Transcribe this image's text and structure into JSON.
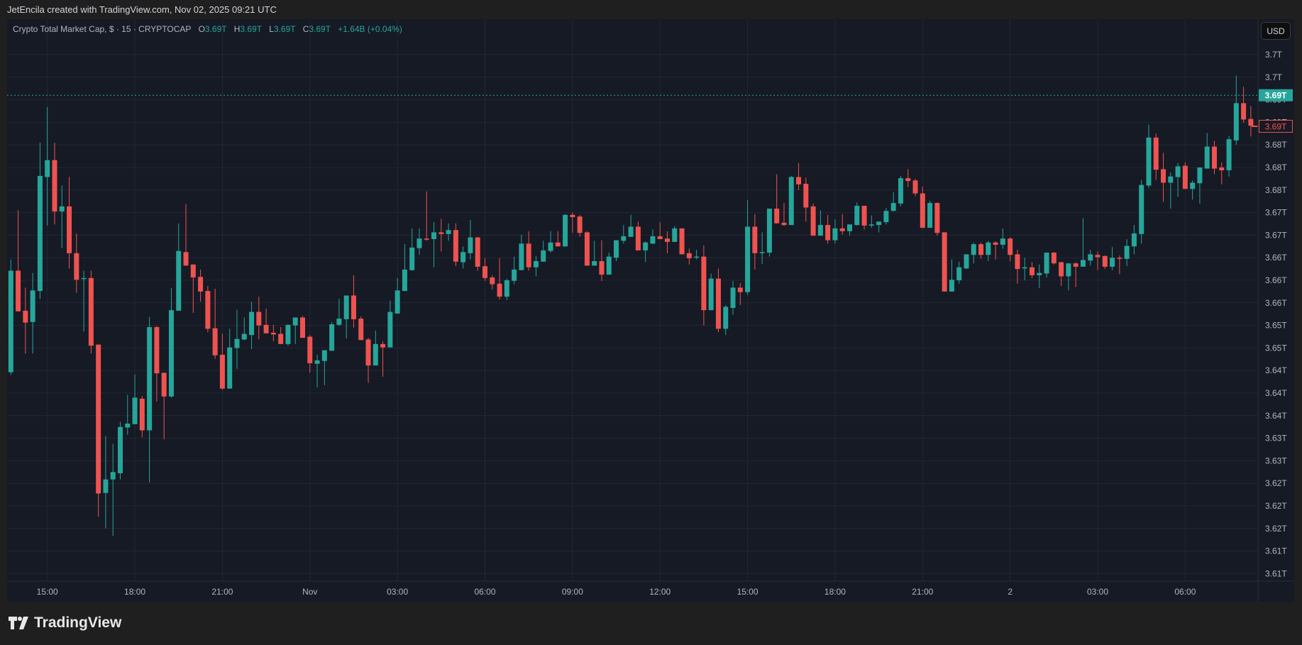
{
  "attribution": "JetEncila created with TradingView.com, Nov 02, 2025 09:21 UTC",
  "legend": {
    "symbol": "Crypto Total Market Cap, $ · 15 · CRYPTOCAP",
    "o_label": "O",
    "o": "3.69T",
    "h_label": "H",
    "h": "3.69T",
    "l_label": "L",
    "l": "3.69T",
    "c_label": "C",
    "c": "3.69T",
    "change": "+1.64B (+0.04%)"
  },
  "currency_button": "USD",
  "logo_text": "TradingView",
  "colors": {
    "up": "#26a69a",
    "down": "#ef5350",
    "grid": "#232734",
    "background": "#161a25",
    "axis_text": "#b2b5be"
  },
  "price_marker": {
    "value": 3.6928,
    "label": "3.69T"
  },
  "last_price": {
    "value": 3.6873,
    "label": "3.69T"
  },
  "price_ticks": [
    {
      "value": 3.7,
      "label": "3.7T"
    },
    {
      "value": 3.696,
      "label": "3.7T"
    },
    {
      "value": 3.692,
      "label": "3.69T"
    },
    {
      "value": 3.688,
      "label": "3.69T"
    },
    {
      "value": 3.684,
      "label": "3.68T"
    },
    {
      "value": 3.68,
      "label": "3.68T"
    },
    {
      "value": 3.676,
      "label": "3.68T"
    },
    {
      "value": 3.672,
      "label": "3.67T"
    },
    {
      "value": 3.668,
      "label": "3.67T"
    },
    {
      "value": 3.664,
      "label": "3.66T"
    },
    {
      "value": 3.66,
      "label": "3.66T"
    },
    {
      "value": 3.656,
      "label": "3.66T"
    },
    {
      "value": 3.652,
      "label": "3.65T"
    },
    {
      "value": 3.648,
      "label": "3.65T"
    },
    {
      "value": 3.644,
      "label": "3.64T"
    },
    {
      "value": 3.64,
      "label": "3.64T"
    },
    {
      "value": 3.636,
      "label": "3.64T"
    },
    {
      "value": 3.632,
      "label": "3.63T"
    },
    {
      "value": 3.628,
      "label": "3.63T"
    },
    {
      "value": 3.624,
      "label": "3.62T"
    },
    {
      "value": 3.62,
      "label": "3.62T"
    },
    {
      "value": 3.616,
      "label": "3.62T"
    },
    {
      "value": 3.612,
      "label": "3.61T"
    },
    {
      "value": 3.608,
      "label": "3.61T"
    }
  ],
  "time_ticks": [
    {
      "bar": 5,
      "label": "15:00"
    },
    {
      "bar": 17,
      "label": "18:00"
    },
    {
      "bar": 29,
      "label": "21:00"
    },
    {
      "bar": 41,
      "label": "Nov"
    },
    {
      "bar": 53,
      "label": "03:00"
    },
    {
      "bar": 65,
      "label": "06:00"
    },
    {
      "bar": 77,
      "label": "09:00"
    },
    {
      "bar": 89,
      "label": "12:00"
    },
    {
      "bar": 101,
      "label": "15:00"
    },
    {
      "bar": 113,
      "label": "18:00"
    },
    {
      "bar": 125,
      "label": "21:00"
    },
    {
      "bar": 137,
      "label": "2"
    },
    {
      "bar": 149,
      "label": "03:00"
    },
    {
      "bar": 161,
      "label": "06:00"
    }
  ],
  "chart_data": {
    "type": "candlestick",
    "title": "Crypto Total Market Cap, $ · 15 · CRYPTOCAP",
    "interval_minutes": 15,
    "unit": "T USD",
    "ylim": [
      3.606,
      3.704
    ],
    "ohlc_order": [
      "open",
      "high",
      "low",
      "close"
    ],
    "ohlc": [
      [
        3.6437,
        3.6637,
        3.6432,
        3.6617
      ],
      [
        3.6617,
        3.6724,
        3.6545,
        3.6545
      ],
      [
        3.6546,
        3.6587,
        3.647,
        3.6525
      ],
      [
        3.6526,
        3.6613,
        3.647,
        3.6582
      ],
      [
        3.6581,
        3.6844,
        3.6567,
        3.6785
      ],
      [
        3.6783,
        3.6907,
        3.6697,
        3.6813
      ],
      [
        3.6813,
        3.6844,
        3.6699,
        3.6722
      ],
      [
        3.6722,
        3.6768,
        3.6657,
        3.6731
      ],
      [
        3.6731,
        3.6783,
        3.6621,
        3.6648
      ],
      [
        3.6648,
        3.6683,
        3.6578,
        3.6601
      ],
      [
        3.6603,
        3.6617,
        3.6509,
        3.6604
      ],
      [
        3.6604,
        3.6617,
        3.647,
        3.6484
      ],
      [
        3.6486,
        3.6486,
        3.6181,
        3.6222
      ],
      [
        3.6223,
        3.6324,
        3.616,
        3.6247
      ],
      [
        3.6247,
        3.631,
        3.6147,
        3.626
      ],
      [
        3.6258,
        3.6349,
        3.6247,
        3.634
      ],
      [
        3.6339,
        3.6397,
        3.6326,
        3.6346
      ],
      [
        3.6345,
        3.6433,
        3.6345,
        3.6392
      ],
      [
        3.639,
        3.6395,
        3.6322,
        3.6334
      ],
      [
        3.6334,
        3.6535,
        3.6242,
        3.6517
      ],
      [
        3.6517,
        3.6519,
        3.6385,
        3.6435
      ],
      [
        3.6436,
        3.6436,
        3.6318,
        3.6394
      ],
      [
        3.6394,
        3.6586,
        3.6392,
        3.6547
      ],
      [
        3.6546,
        3.6701,
        3.6546,
        3.6652
      ],
      [
        3.665,
        3.6735,
        3.6626,
        3.6626
      ],
      [
        3.6628,
        3.6628,
        3.6542,
        3.6605
      ],
      [
        3.6606,
        3.6619,
        3.6562,
        3.658
      ],
      [
        3.6581,
        3.659,
        3.6508,
        3.6514
      ],
      [
        3.6515,
        3.6585,
        3.6461,
        3.6467
      ],
      [
        3.6468,
        3.6505,
        3.6406,
        3.6408
      ],
      [
        3.6408,
        3.6514,
        3.6408,
        3.6481
      ],
      [
        3.648,
        3.6548,
        3.6443,
        3.6496
      ],
      [
        3.6495,
        3.6534,
        3.6494,
        3.6505
      ],
      [
        3.6503,
        3.6562,
        3.6478,
        3.6544
      ],
      [
        3.6544,
        3.6571,
        3.6495,
        3.652
      ],
      [
        3.6521,
        3.655,
        3.6506,
        3.6506
      ],
      [
        3.6507,
        3.6521,
        3.6492,
        3.6504
      ],
      [
        3.6505,
        3.6517,
        3.6487,
        3.6487
      ],
      [
        3.6487,
        3.6522,
        3.6484,
        3.6521
      ],
      [
        3.652,
        3.6534,
        3.6487,
        3.6534
      ],
      [
        3.6534,
        3.6537,
        3.6498,
        3.6498
      ],
      [
        3.65,
        3.6503,
        3.6436,
        3.6453
      ],
      [
        3.6452,
        3.6468,
        3.641,
        3.6458
      ],
      [
        3.6457,
        3.6476,
        3.6414,
        3.6476
      ],
      [
        3.6475,
        3.6526,
        3.6475,
        3.6522
      ],
      [
        3.6521,
        3.6567,
        3.6519,
        3.6532
      ],
      [
        3.6531,
        3.6573,
        3.6497,
        3.6573
      ],
      [
        3.6573,
        3.6609,
        3.6516,
        3.6531
      ],
      [
        3.6532,
        3.6536,
        3.6494,
        3.6494
      ],
      [
        3.6495,
        3.6498,
        3.6418,
        3.6449
      ],
      [
        3.6449,
        3.6511,
        3.6449,
        3.6487
      ],
      [
        3.6487,
        3.6492,
        3.6429,
        3.6481
      ],
      [
        3.6481,
        3.6564,
        3.6481,
        3.6544
      ],
      [
        3.6541,
        3.6604,
        3.6541,
        3.6582
      ],
      [
        3.6581,
        3.6664,
        3.6581,
        3.6619
      ],
      [
        3.6618,
        3.6692,
        3.6617,
        3.6658
      ],
      [
        3.6657,
        3.6692,
        3.6645,
        3.6674
      ],
      [
        3.6674,
        3.6758,
        3.667,
        3.6672
      ],
      [
        3.6673,
        3.6703,
        3.6623,
        3.6685
      ],
      [
        3.6685,
        3.6709,
        3.6651,
        3.6682
      ],
      [
        3.6682,
        3.6701,
        3.667,
        3.6689
      ],
      [
        3.6689,
        3.6701,
        3.6625,
        3.6633
      ],
      [
        3.6632,
        3.666,
        3.6621,
        3.665
      ],
      [
        3.6648,
        3.6707,
        3.6637,
        3.6676
      ],
      [
        3.6676,
        3.6677,
        3.6617,
        3.6624
      ],
      [
        3.6625,
        3.6639,
        3.6599,
        3.6604
      ],
      [
        3.6605,
        3.6609,
        3.6584,
        3.6593
      ],
      [
        3.6594,
        3.6639,
        3.6566,
        3.6571
      ],
      [
        3.6571,
        3.6603,
        3.6565,
        3.66
      ],
      [
        3.6599,
        3.6642,
        3.6593,
        3.6619
      ],
      [
        3.6618,
        3.6681,
        3.6618,
        3.6665
      ],
      [
        3.6665,
        3.6687,
        3.6617,
        3.6623
      ],
      [
        3.6623,
        3.6643,
        3.6607,
        3.6634
      ],
      [
        3.6633,
        3.667,
        3.6633,
        3.6653
      ],
      [
        3.6652,
        3.6687,
        3.6649,
        3.6667
      ],
      [
        3.6667,
        3.6687,
        3.666,
        3.666
      ],
      [
        3.666,
        3.6717,
        3.666,
        3.6716
      ],
      [
        3.6716,
        3.672,
        3.6684,
        3.6712
      ],
      [
        3.6713,
        3.6716,
        3.6677,
        3.6684
      ],
      [
        3.6685,
        3.6687,
        3.6626,
        3.6626
      ],
      [
        3.6626,
        3.667,
        3.6626,
        3.6634
      ],
      [
        3.6634,
        3.6671,
        3.6599,
        3.661
      ],
      [
        3.661,
        3.6649,
        3.661,
        3.6642
      ],
      [
        3.664,
        3.6671,
        3.6634,
        3.6671
      ],
      [
        3.667,
        3.6698,
        3.6665,
        3.6678
      ],
      [
        3.6677,
        3.6716,
        3.6677,
        3.6695
      ],
      [
        3.6695,
        3.6704,
        3.6653,
        3.6653
      ],
      [
        3.6653,
        3.6669,
        3.6632,
        3.6667
      ],
      [
        3.6665,
        3.669,
        3.6664,
        3.6678
      ],
      [
        3.6678,
        3.6703,
        3.6673,
        3.6673
      ],
      [
        3.6674,
        3.6687,
        3.6648,
        3.6668
      ],
      [
        3.6668,
        3.6696,
        3.6668,
        3.6692
      ],
      [
        3.6692,
        3.6692,
        3.6646,
        3.6646
      ],
      [
        3.6648,
        3.6656,
        3.6628,
        3.6639
      ],
      [
        3.6641,
        3.6654,
        3.6637,
        3.6642
      ],
      [
        3.6642,
        3.6662,
        3.652,
        3.6547
      ],
      [
        3.6547,
        3.6612,
        3.6547,
        3.6603
      ],
      [
        3.6603,
        3.6621,
        3.6508,
        3.6514
      ],
      [
        3.6514,
        3.6556,
        3.6503,
        3.6553
      ],
      [
        3.6551,
        3.6599,
        3.6539,
        3.6587
      ],
      [
        3.6587,
        3.6595,
        3.6556,
        3.6579
      ],
      [
        3.6579,
        3.6742,
        3.6574,
        3.6695
      ],
      [
        3.6695,
        3.6717,
        3.6619,
        3.6648
      ],
      [
        3.6648,
        3.6685,
        3.6629,
        3.665
      ],
      [
        3.6649,
        3.6727,
        3.6642,
        3.6727
      ],
      [
        3.6727,
        3.6788,
        3.6701,
        3.6701
      ],
      [
        3.6702,
        3.6737,
        3.6696,
        3.6698
      ],
      [
        3.6698,
        3.6785,
        3.6698,
        3.6783
      ],
      [
        3.6783,
        3.6808,
        3.676,
        3.677
      ],
      [
        3.6771,
        3.6782,
        3.6704,
        3.6729
      ],
      [
        3.6731,
        3.6736,
        3.6679,
        3.6679
      ],
      [
        3.6679,
        3.6724,
        3.6679,
        3.6698
      ],
      [
        3.6698,
        3.6716,
        3.6665,
        3.6671
      ],
      [
        3.6671,
        3.6708,
        3.6665,
        3.6692
      ],
      [
        3.6692,
        3.6717,
        3.6681,
        3.6687
      ],
      [
        3.6687,
        3.6699,
        3.6679,
        3.6699
      ],
      [
        3.6698,
        3.6738,
        3.6697,
        3.6732
      ],
      [
        3.6732,
        3.6732,
        3.669,
        3.6697
      ],
      [
        3.6697,
        3.6715,
        3.6693,
        3.6699
      ],
      [
        3.6698,
        3.6704,
        3.6685,
        3.6704
      ],
      [
        3.6703,
        3.6728,
        3.6699,
        3.6723
      ],
      [
        3.6723,
        3.6756,
        3.6722,
        3.6737
      ],
      [
        3.6736,
        3.6785,
        3.6731,
        3.6781
      ],
      [
        3.6781,
        3.6797,
        3.6765,
        3.6776
      ],
      [
        3.6777,
        3.678,
        3.6749,
        3.6754
      ],
      [
        3.6754,
        3.6766,
        3.6693,
        3.6693
      ],
      [
        3.6693,
        3.6741,
        3.6693,
        3.6737
      ],
      [
        3.6737,
        3.6738,
        3.6679,
        3.6684
      ],
      [
        3.6685,
        3.6685,
        3.658,
        3.658
      ],
      [
        3.658,
        3.6637,
        3.658,
        3.6601
      ],
      [
        3.66,
        3.6633,
        3.6594,
        3.6623
      ],
      [
        3.6621,
        3.6646,
        3.662,
        3.6646
      ],
      [
        3.6645,
        3.6667,
        3.663,
        3.6664
      ],
      [
        3.6664,
        3.6667,
        3.6638,
        3.6645
      ],
      [
        3.6645,
        3.667,
        3.6634,
        3.6667
      ],
      [
        3.6667,
        3.6669,
        3.6637,
        3.6663
      ],
      [
        3.6663,
        3.6692,
        3.6656,
        3.6674
      ],
      [
        3.6674,
        3.6676,
        3.6634,
        3.6645
      ],
      [
        3.6646,
        3.6654,
        3.6594,
        3.662
      ],
      [
        3.6621,
        3.664,
        3.66,
        3.6623
      ],
      [
        3.6623,
        3.6632,
        3.6604,
        3.6609
      ],
      [
        3.6609,
        3.6628,
        3.6586,
        3.6613
      ],
      [
        3.6612,
        3.6649,
        3.6605,
        3.6649
      ],
      [
        3.6649,
        3.665,
        3.6628,
        3.663
      ],
      [
        3.6632,
        3.6633,
        3.659,
        3.6607
      ],
      [
        3.6607,
        3.663,
        3.6582,
        3.663
      ],
      [
        3.663,
        3.6632,
        3.6588,
        3.6624
      ],
      [
        3.6624,
        3.671,
        3.6624,
        3.6636
      ],
      [
        3.6635,
        3.6654,
        3.6626,
        3.6646
      ],
      [
        3.6645,
        3.6651,
        3.6618,
        3.6641
      ],
      [
        3.6643,
        3.6644,
        3.662,
        3.6624
      ],
      [
        3.6624,
        3.6659,
        3.6618,
        3.664
      ],
      [
        3.664,
        3.6644,
        3.6611,
        3.6639
      ],
      [
        3.6638,
        3.6673,
        3.6625,
        3.6661
      ],
      [
        3.666,
        3.6698,
        3.6646,
        3.6683
      ],
      [
        3.6682,
        3.6778,
        3.6665,
        3.6769
      ],
      [
        3.6768,
        3.6876,
        3.6764,
        3.6853
      ],
      [
        3.6853,
        3.686,
        3.6778,
        3.6796
      ],
      [
        3.6797,
        3.6826,
        3.6739,
        3.6773
      ],
      [
        3.6773,
        3.6791,
        3.6727,
        3.6784
      ],
      [
        3.6783,
        3.6808,
        3.6748,
        3.6802
      ],
      [
        3.6803,
        3.6809,
        3.6762,
        3.6762
      ],
      [
        3.6762,
        3.6777,
        3.6743,
        3.6773
      ],
      [
        3.6772,
        3.68,
        3.6736,
        3.68
      ],
      [
        3.6798,
        3.6861,
        3.6798,
        3.6837
      ],
      [
        3.6837,
        3.6847,
        3.6788,
        3.6798
      ],
      [
        3.68,
        3.6809,
        3.677,
        3.6795
      ],
      [
        3.6795,
        3.6856,
        3.6784,
        3.685
      ],
      [
        3.6848,
        3.6963,
        3.684,
        3.6914
      ],
      [
        3.6914,
        3.6943,
        3.6879,
        3.6885
      ],
      [
        3.6886,
        3.6909,
        3.6855,
        3.6874
      ],
      [
        3.6874,
        3.6874,
        3.6873,
        3.6873
      ]
    ]
  }
}
